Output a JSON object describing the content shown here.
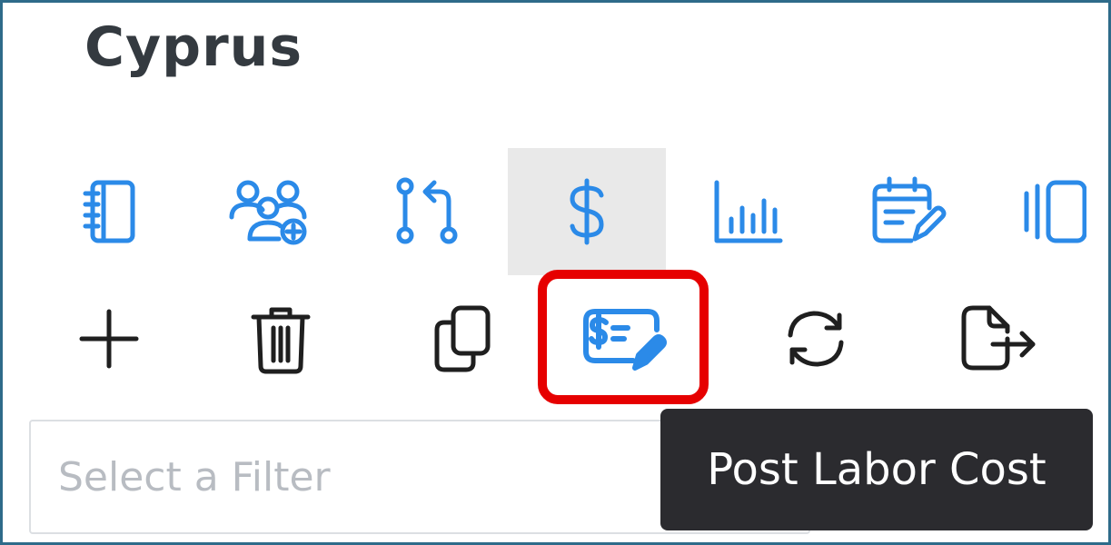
{
  "header": {
    "title": "Cyprus"
  },
  "nav_toolbar": {
    "items": [
      {
        "icon": "notebook-icon",
        "active": false
      },
      {
        "icon": "people-add-icon",
        "active": false
      },
      {
        "icon": "branch-merge-icon",
        "active": false
      },
      {
        "icon": "dollar-icon",
        "active": true
      },
      {
        "icon": "bar-chart-icon",
        "active": false
      },
      {
        "icon": "calendar-edit-icon",
        "active": false
      },
      {
        "icon": "panel-icon",
        "active": false
      }
    ]
  },
  "action_toolbar": {
    "items": [
      {
        "icon": "plus-icon"
      },
      {
        "icon": "trash-icon"
      },
      {
        "icon": "copy-icon"
      },
      {
        "icon": "post-labor-cost-icon",
        "highlighted": true
      },
      {
        "icon": "refresh-icon"
      },
      {
        "icon": "export-icon"
      }
    ]
  },
  "filter": {
    "placeholder": "Select a Filter"
  },
  "tooltip": {
    "text": "Post Labor Cost"
  },
  "colors": {
    "accent": "#2b8ae8",
    "dark_icon": "#1f1f1f",
    "highlight": "#e60000",
    "title": "#343a40",
    "tooltip_bg": "#2b2b2f"
  }
}
